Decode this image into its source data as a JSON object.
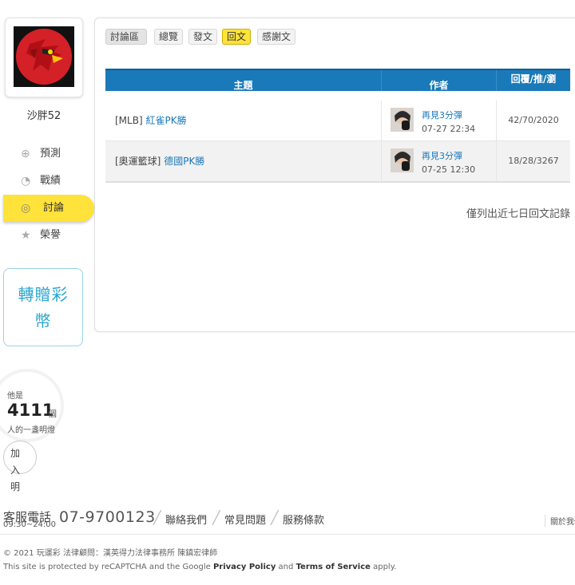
{
  "user": {
    "name": "沙胖52"
  },
  "sidebar": {
    "items": [
      {
        "label": "預測",
        "icon": "target-icon",
        "active": false
      },
      {
        "label": "戰績",
        "icon": "chart-bubble-icon",
        "active": false
      },
      {
        "label": "討論",
        "icon": "chat-search-icon",
        "active": true
      },
      {
        "label": "榮譽",
        "icon": "medal-icon",
        "active": false
      }
    ],
    "gift_button": "轉贈彩幣"
  },
  "lamp": {
    "prefix": "他是",
    "count": "4111",
    "unit": "個",
    "desc": "人的一盞明燈",
    "join": "加入明"
  },
  "tabs": [
    "討論區",
    "總覽",
    "發文",
    "回文",
    "感謝文"
  ],
  "active_tab": "回文",
  "table": {
    "headers": [
      "主題",
      "作者",
      "回覆/推/瀏"
    ],
    "rows": [
      {
        "category": "[MLB]",
        "title": "紅雀PK勝",
        "author": "再見3分彈",
        "time": "07-27 22:34",
        "stats": "42/70/2020"
      },
      {
        "category": "[奧運籃球]",
        "title": "德國PK勝",
        "author": "再見3分彈",
        "time": "07-25 12:30",
        "stats": "18/28/3267"
      }
    ]
  },
  "note": "僅列出近七日回文記錄",
  "footer": {
    "cs_label": "客服電話",
    "cs_hours": "09:30~24:00",
    "cs_phone": "07-9700123",
    "links": [
      "聯絡我們",
      "常見問題",
      "服務條款"
    ],
    "about": "關於我們",
    "copyright": "© 2021 玩運彩 法律顧問：漢英得力法律事務所 陳鎮宏律師",
    "recaptcha_pre": "This site is protected by reCAPTCHA and the Google",
    "privacy": "Privacy Policy",
    "and": "and",
    "terms": "Terms of Service",
    "apply": "apply."
  },
  "colors": {
    "accent_yellow": "#ffe23a",
    "header_blue": "#1a79b9",
    "gift_teal": "#2aa6cf"
  }
}
